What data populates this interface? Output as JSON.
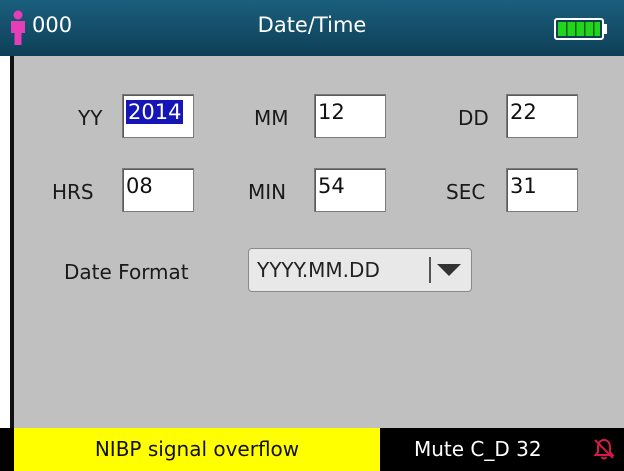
{
  "header": {
    "patient_id": "000",
    "title": "Date/Time"
  },
  "date": {
    "yy_label": "YY",
    "yy_value": "2014",
    "mm_label": "MM",
    "mm_value": "12",
    "dd_label": "DD",
    "dd_value": "22"
  },
  "time": {
    "hrs_label": "HRS",
    "hrs_value": "08",
    "min_label": "MIN",
    "min_value": "54",
    "sec_label": "SEC",
    "sec_value": "31"
  },
  "format": {
    "label": "Date Format",
    "value": "YYYY.MM.DD"
  },
  "status": {
    "alarm_message": "NIBP signal overflow",
    "mute_text": "Mute C_D 32"
  },
  "icons": {
    "patient": "patient-icon",
    "battery": "battery-icon",
    "dropdown": "triangle-down-icon",
    "alarm": "alarm-bell-off-icon"
  },
  "colors": {
    "titlebar": "#0e3f56",
    "patient_icon": "#e63db8",
    "battery": "#22d41c",
    "selection": "#1515b8",
    "alarm_background": "#ffff00",
    "bell": "#d21a4a"
  }
}
